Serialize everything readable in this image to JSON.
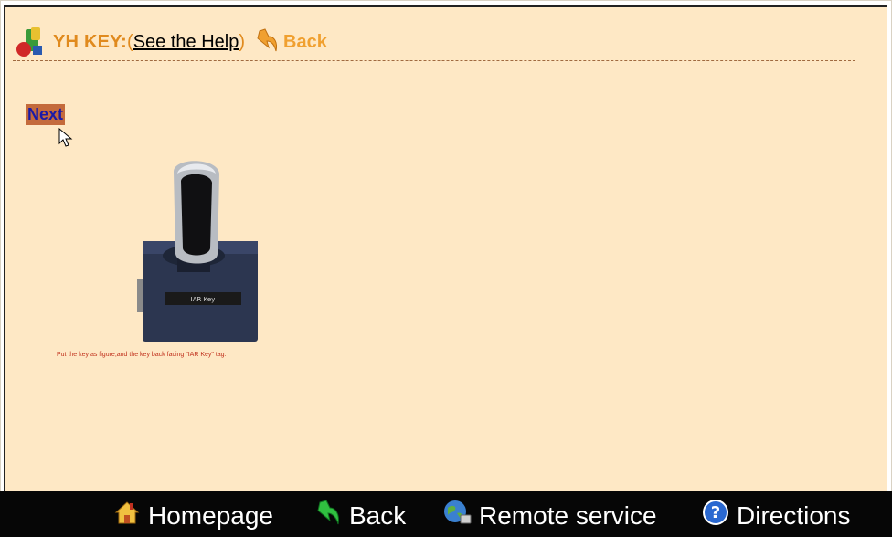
{
  "header": {
    "title": "YH KEY:",
    "paren_open": "(",
    "help_link": "See the Help",
    "paren_close": ")",
    "back_label": "Back"
  },
  "main": {
    "next_button": "Next",
    "caption": "Put the key as figure,and the key back facing \"IAR Key\" tag.",
    "device_tag": "IAR Key"
  },
  "bottom_nav": {
    "homepage": "Homepage",
    "back": "Back",
    "remote_service": "Remote service",
    "directions": "Directions"
  },
  "icons": {
    "logo": "yh-key-logo-icon",
    "back_arrow": "back-arrow-icon",
    "home": "home-icon",
    "remote": "remote-service-icon",
    "directions": "help-circle-icon"
  },
  "colors": {
    "content_bg": "#fee8c5",
    "title_orange": "#e08a1e",
    "bar_bg": "#060606",
    "caption_red": "#c0301c"
  }
}
